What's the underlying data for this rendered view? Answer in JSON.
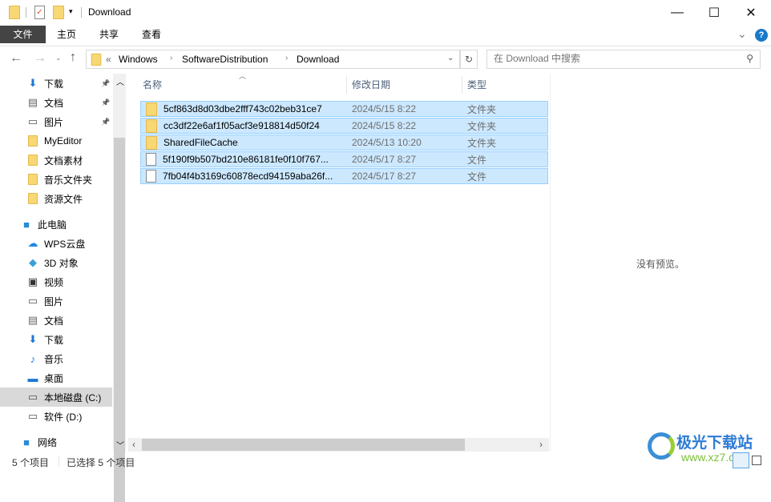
{
  "window": {
    "title": "Download",
    "min": "—",
    "max": "☐",
    "close": "✕"
  },
  "ribbon": {
    "tabs": [
      "文件",
      "主页",
      "共享",
      "查看"
    ],
    "help": "?",
    "expand": "⌄"
  },
  "address": {
    "crumbs": [
      "Windows",
      "SoftwareDistribution",
      "Download"
    ],
    "prefix": "«",
    "refresh": "↻",
    "search_placeholder": "在 Download 中搜索"
  },
  "sidebar": {
    "quick": [
      {
        "label": "下载",
        "icon": "download-icon"
      },
      {
        "label": "文档",
        "icon": "document-icon"
      },
      {
        "label": "图片",
        "icon": "picture-icon"
      },
      {
        "label": "MyEditor",
        "icon": "folder-icon"
      },
      {
        "label": "文档素材",
        "icon": "folder-icon"
      },
      {
        "label": "音乐文件夹",
        "icon": "folder-icon"
      },
      {
        "label": "资源文件",
        "icon": "folder-icon"
      }
    ],
    "pc": {
      "label": "此电脑"
    },
    "pc_items": [
      {
        "label": "WPS云盘"
      },
      {
        "label": "3D 对象"
      },
      {
        "label": "视频"
      },
      {
        "label": "图片"
      },
      {
        "label": "文档"
      },
      {
        "label": "下载"
      },
      {
        "label": "音乐"
      },
      {
        "label": "桌面"
      },
      {
        "label": "本地磁盘 (C:)"
      },
      {
        "label": "软件 (D:)"
      }
    ],
    "network": {
      "label": "网络"
    }
  },
  "columns": {
    "name": "名称",
    "date": "修改日期",
    "type": "类型"
  },
  "files": [
    {
      "name": "5cf863d8d03dbe2fff743c02beb31ce7",
      "date": "2024/5/15 8:22",
      "type": "文件夹",
      "kind": "folder"
    },
    {
      "name": "cc3df22e6af1f05acf3e918814d50f24",
      "date": "2024/5/15 8:22",
      "type": "文件夹",
      "kind": "folder"
    },
    {
      "name": "SharedFileCache",
      "date": "2024/5/13 10:20",
      "type": "文件夹",
      "kind": "folder"
    },
    {
      "name": "5f190f9b507bd210e86181fe0f10f767...",
      "date": "2024/5/17 8:27",
      "type": "文件",
      "kind": "file"
    },
    {
      "name": "7fb04f4b3169c60878ecd94159aba26f...",
      "date": "2024/5/17 8:27",
      "type": "文件",
      "kind": "file"
    }
  ],
  "preview": {
    "text": "没有预览。"
  },
  "status": {
    "count": "5 个项目",
    "selected": "已选择 5 个项目"
  },
  "watermark": {
    "name": "极光下载站",
    "url": "www.xz7.com"
  }
}
